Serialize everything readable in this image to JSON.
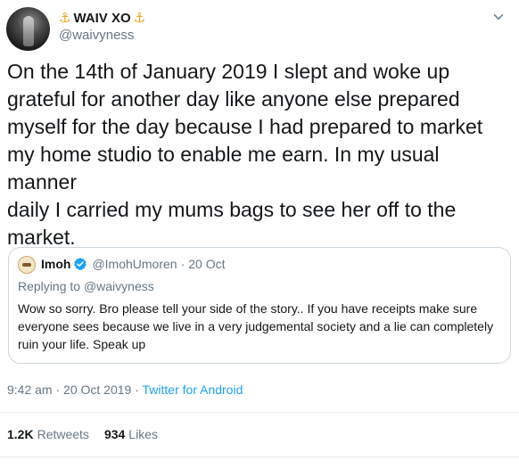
{
  "tweet": {
    "display_name": "WAIV XO",
    "handle": "@waivyness",
    "text": "On the 14th of January 2019 I slept and woke up\ngrateful for another day like anyone else prepared\nmyself for the day because I had prepared to market\nmy home studio to enable me earn. In my usual manner\ndaily I carried my mums bags to see her off to the\nmarket.",
    "time": "9:42 am",
    "date": "20 Oct 2019",
    "separator": "·",
    "source": "Twitter for Android",
    "icons": {
      "name_decoration": "anchor-icon",
      "more": "chevron-down-icon"
    }
  },
  "quote": {
    "name": "Imoh",
    "handle": "@ImohUmoren",
    "separator": "·",
    "date": "20 Oct",
    "replying_prefix": "Replying to",
    "replying_to": "@waivyness",
    "text": "Wow so sorry. Bro please tell your side of the story.. If you have receipts make sure everyone sees because we live in a very judgemental society and a lie can completely ruin your life. Speak up",
    "verified_icon": "verified-badge-icon"
  },
  "stats": {
    "retweets_count": "1.2K",
    "retweets_label": "Retweets",
    "likes_count": "934",
    "likes_label": "Likes"
  },
  "colors": {
    "text": "#14171a",
    "muted": "#657786",
    "link": "#1da1f2",
    "accent_gold": "#e8a317",
    "border": "#ccd6dd"
  }
}
